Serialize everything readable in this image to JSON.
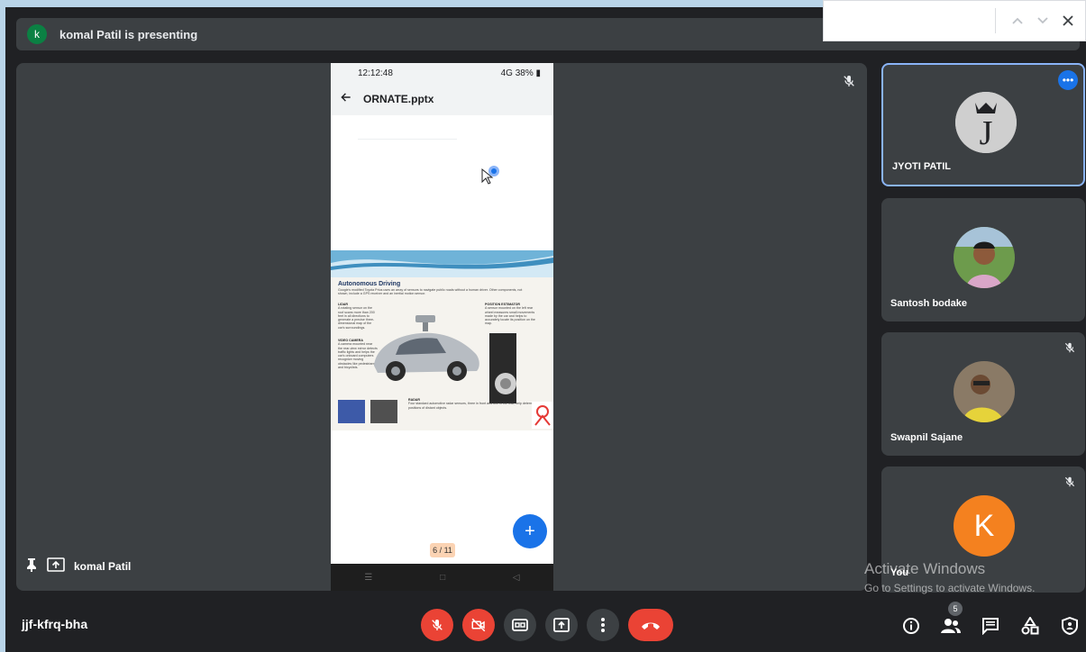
{
  "banner": {
    "avatar_letter": "k",
    "title": "komal Patil is presenting"
  },
  "findbar": {
    "up_icon": "chevron-up-icon",
    "down_icon": "chevron-down-icon",
    "close_icon": "close-icon"
  },
  "stage": {
    "presenter_name": "komal Patil"
  },
  "phone": {
    "time": "12:12:48",
    "status_right": "4G 38% ▮",
    "file_title": "ORNATE.pptx",
    "page_indicator": "6 / 11",
    "fab_label": "+",
    "nav_items": [
      "☰",
      "□",
      "◁"
    ],
    "slide": {
      "title": "Autonomous Driving",
      "subtitle": "Google's modified Toyota Prius uses an array of sensors to navigate public roads without a human driver. Other components, not shown, include a GPS receiver and an inertial motion sensor.",
      "left_blocks": [
        {
          "head": "LIDAR",
          "text": "A rotating sensor on the roof scans more than 200 feet in all directions to generate a precise three-dimensional map of the car's surroundings."
        },
        {
          "head": "VIDEO CAMERA",
          "text": "A camera mounted near the rear-view mirror detects traffic lights and helps the car's onboard computers recognize moving obstacles like pedestrians and bicyclists."
        }
      ],
      "right_blocks": [
        {
          "head": "POSITION ESTIMATOR",
          "text": "A sensor mounted on the left rear wheel measures small movements made by the car and helps to accurately locate its position on the map."
        }
      ],
      "bottom_block": {
        "head": "RADAR",
        "text": "Four standard automotive radar sensors, three in front and one in the rear, help determine the positions of distant objects."
      }
    }
  },
  "participants": [
    {
      "name": "JYOTI PATIL",
      "avatar_letter": "J",
      "active": true
    },
    {
      "name": "Santosh bodake"
    },
    {
      "name": "Swapnil Sajane"
    },
    {
      "name": "You",
      "avatar_letter": "K"
    }
  ],
  "watermark": {
    "line1": "Activate Windows",
    "line2": "Go to Settings to activate Windows."
  },
  "toolbar": {
    "meeting_code": "jjf-kfrq-bha",
    "people_count": "5"
  },
  "colors": {
    "background": "#202124",
    "tile": "#3c4043",
    "red": "#ea4335",
    "blue": "#1a73e8",
    "active_border": "#8ab4f8"
  }
}
